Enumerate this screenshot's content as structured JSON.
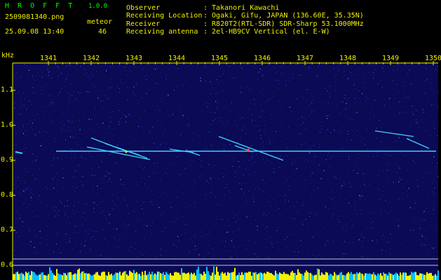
{
  "header": {
    "app_title": "H R O F F T",
    "version": "1.0.0",
    "filename": "2509081340.png",
    "datetime": "25.09.08 13:40",
    "meteor_label": "meteor",
    "meteor_count": "46",
    "observer_label": "Observer",
    "observer_value": ": Takanori Kawachi",
    "location_label": "Receiving Location",
    "location_value": ": Ogaki, Gifu, JAPAN (136.60E, 35.35N)",
    "receiver_label": "Receiver",
    "receiver_value": ": R820T2(RTL-SDR) SDR-Sharp 53.1000MHz",
    "antenna_label": "Receiving antenna",
    "antenna_value": ": 2el-HB9CV Vertical (el. E-W)"
  },
  "axes": {
    "y_unit": "kHz",
    "x_ticks": [
      "1341",
      "1342",
      "1343",
      "1344",
      "1345",
      "1346",
      "1347",
      "1348",
      "1349",
      "1350"
    ],
    "y_ticks": [
      "1.1",
      "1.0",
      "0.9",
      "0.8",
      "0.7",
      "0.6"
    ]
  },
  "colors": {
    "background": "#000000",
    "plot_bg": "#0a0a55",
    "yellow": "#f0f000",
    "green": "#00ff00",
    "cyan": "#40d0ff",
    "bar_yellow": "#f0f000",
    "bar_cyan": "#00c0ff"
  }
}
